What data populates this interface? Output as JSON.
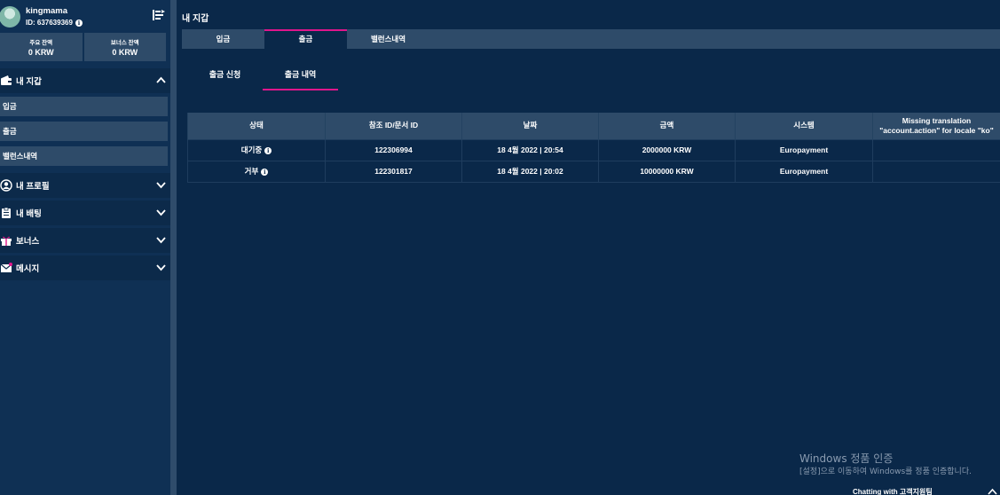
{
  "user": {
    "name": "kingmama",
    "id": "ID: 637639369"
  },
  "balances": [
    {
      "label": "주요 잔액",
      "value": "0 KRW"
    },
    {
      "label": "보너스 잔액",
      "value": "0 KRW"
    }
  ],
  "sidebar": {
    "wallet": {
      "label": "내 지갑",
      "items": [
        {
          "label": "입금"
        },
        {
          "label": "출금"
        },
        {
          "label": "밸런스내역"
        }
      ]
    },
    "menus": [
      {
        "label": "내 프로필",
        "icon": "profile-icon"
      },
      {
        "label": "내 배팅",
        "icon": "clipboard-icon"
      },
      {
        "label": "보너스",
        "icon": "gift-icon"
      },
      {
        "label": "메시지",
        "icon": "mail-icon"
      }
    ]
  },
  "main": {
    "title": "내 지갑",
    "tabs": [
      {
        "label": "입금",
        "active": false
      },
      {
        "label": "출금",
        "active": true
      },
      {
        "label": "밸런스내역",
        "active": false
      }
    ],
    "subtabs": [
      {
        "label": "출금 신청",
        "active": false
      },
      {
        "label": "출금 내역",
        "active": true
      }
    ],
    "table": {
      "headers": [
        "상태",
        "참조 ID/문서 ID",
        "날짜",
        "금액",
        "시스템",
        "Missing translation \"account.action\" for locale \"ko\""
      ],
      "rows": [
        {
          "status": "대기중",
          "ref": "122306994",
          "date": "18 4월 2022 | 20:54",
          "amount": "2000000 KRW",
          "system": "Europayment",
          "action": ""
        },
        {
          "status": "거부",
          "ref": "122301817",
          "date": "18 4월 2022 | 20:02",
          "amount": "10000000 KRW",
          "system": "Europayment",
          "action": ""
        }
      ]
    }
  },
  "watermark": {
    "line1": "Windows 정품 인증",
    "line2": "[설정]으로 이동하여 Windows를 정품 인증합니다."
  },
  "chat": {
    "label": "Chatting with 고객지원팀"
  },
  "colors": {
    "background": "#0a2849",
    "panel": "#2e4b69",
    "accent": "#e0168c"
  }
}
